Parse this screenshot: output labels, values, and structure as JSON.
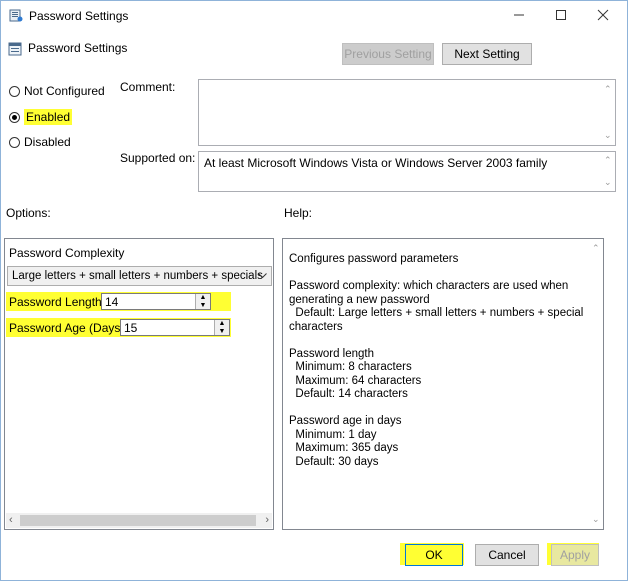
{
  "window": {
    "title": "Password Settings"
  },
  "header": {
    "title": "Password Settings"
  },
  "nav": {
    "prev_label": "Previous Setting",
    "next_label": "Next Setting"
  },
  "state": {
    "options": [
      {
        "label": "Not Configured",
        "checked": false
      },
      {
        "label": "Enabled",
        "checked": true
      },
      {
        "label": "Disabled",
        "checked": false
      }
    ]
  },
  "comment": {
    "label": "Comment:",
    "value": ""
  },
  "supported": {
    "label": "Supported on:",
    "value": "At least Microsoft Windows Vista or Windows Server 2003 family"
  },
  "options_section": {
    "label": "Options:",
    "complexity_label": "Password Complexity",
    "complexity_value": "Large letters + small letters + numbers + specials",
    "length_label": "Password Length",
    "length_value": "14",
    "age_label": "Password Age (Days)",
    "age_value": "15"
  },
  "help_section": {
    "label": "Help:",
    "text": "Configures password parameters\n\nPassword complexity: which characters are used when\ngenerating a new password\n  Default: Large letters + small letters + numbers + special\ncharacters\n\nPassword length\n  Minimum: 8 characters\n  Maximum: 64 characters\n  Default: 14 characters\n\nPassword age in days\n  Minimum: 1 day\n  Maximum: 365 days\n  Default: 30 days"
  },
  "footer": {
    "ok_label": "OK",
    "cancel_label": "Cancel",
    "apply_label": "Apply"
  },
  "colors": {
    "highlight": "#ffff33",
    "border": "#8fb3d9"
  },
  "icons": [
    "policy-icon",
    "minimize-icon",
    "maximize-icon",
    "close-icon",
    "chevron-down-icon",
    "spin-up-icon",
    "spin-down-icon"
  ]
}
